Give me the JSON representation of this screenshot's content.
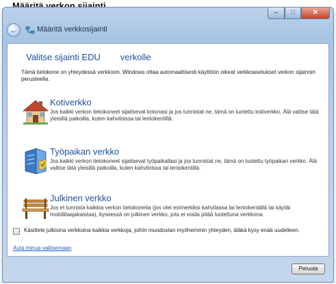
{
  "window": {
    "caption_text": "Määritä verkon sijainti",
    "title": "Määritä verkkosijainti",
    "caption_buttons": {
      "minimize": "–",
      "maximize": "□",
      "close": "✕"
    },
    "back_icon": "←"
  },
  "page": {
    "heading": "Valitse sijainti EDU        verkolle",
    "intro": "Tämä tietokone on yhteydessä verkkoon. Windows ottaa automaattisesti käyttöön oikeat verkkoasetukset verkon sijainnin perusteella."
  },
  "options": [
    {
      "title": "Kotiverkko",
      "description": "Jos kaikki verkon tietokoneet sijaitsevat kotonasi ja jos tunnistat ne, tämä on luotettu kotiverkko. Älä valitse tätä yleisillä paikoilla, kuten kahviloissa tai lentokentillä.",
      "icon": "home-network-icon"
    },
    {
      "title": "Työpaikan verkko",
      "description": "Jos kaikki verkon tietokoneet sijaitsevat työpaikallasi ja jos tunnistat ne, tämä on luotettu työpaikan verkko. Älä valitse tätä yleisillä paikoilla, kuten kahviloissa tai lentokentillä.",
      "icon": "work-network-icon"
    },
    {
      "title": "Julkinen verkko",
      "description": "Jos et tunnista kaikkia verkon tietokoneita (jos olet esimerkiksi kahvilassa tai lentokentällä tai käytät mobiililaajakaistaa), kyseessä on julkinen verkko, jota ei voida pitää luotettuna verkkona.",
      "icon": "public-network-icon"
    }
  ],
  "checkbox": {
    "label": "Käsittele julkisina verkkoina kaikkia verkkoja, joihin muodostan myöhemmin yhteyden, äläkä kysy enää uudelleen.",
    "checked": false
  },
  "help_link": "Auta minua valitsemaan",
  "buttons": {
    "cancel": "Peruuta"
  },
  "colors": {
    "heading": "#1e4d9b",
    "link": "#1f57c2",
    "frame": "#a7c4e3"
  }
}
